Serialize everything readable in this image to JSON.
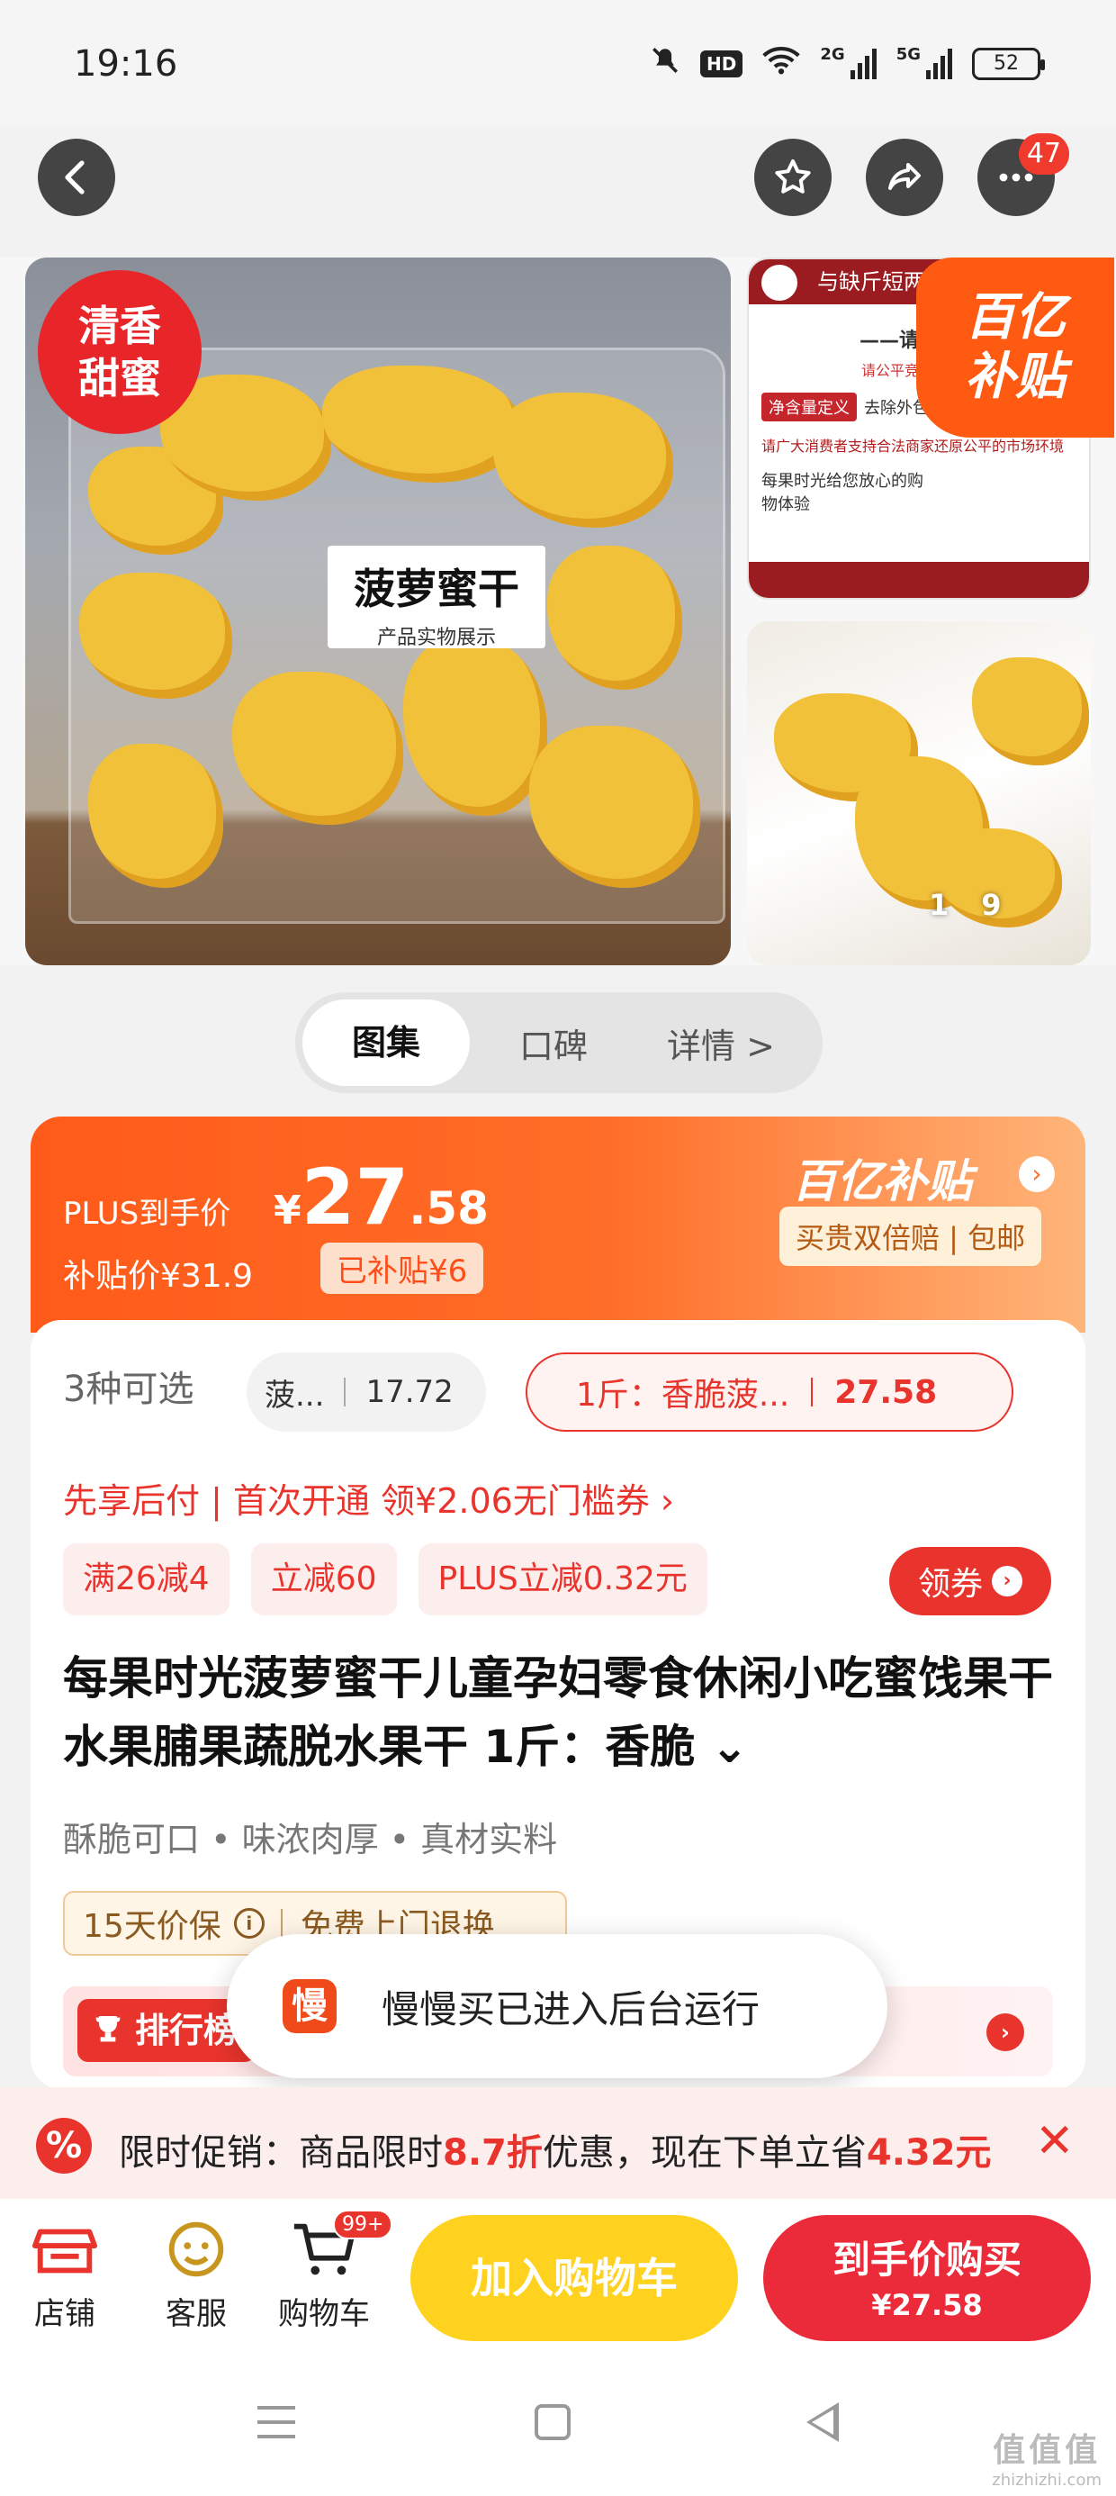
{
  "status_bar": {
    "time": "19:16",
    "hd": "HD",
    "net1": "2G",
    "net2": "5G",
    "battery": "52"
  },
  "top_nav": {
    "message_badge": "47"
  },
  "gallery": {
    "main_tag_line1": "清香",
    "main_tag_line2": "甜蜜",
    "product_label": "菠萝蜜干",
    "product_label_sub": "产品实物展示",
    "side1_header": "与缺斤短两",
    "side1_title": "——请认准购",
    "side1_sub": "请公平竞争，拒绝",
    "side1_pill": "净含量定义",
    "side1_pill_text": "去除外包装产品的净重",
    "side1_red": "请广大消费者支持合法商家还原公平的市场环境",
    "side1_small": "每果时光给您放心的购物体验",
    "subsidy_line1": "百亿",
    "subsidy_line2": "补贴",
    "page_current": "1",
    "page_total": "9"
  },
  "tabs": [
    {
      "label": "图集",
      "active": true
    },
    {
      "label": "口碑",
      "active": false
    },
    {
      "label": "详情 >",
      "active": false
    }
  ],
  "price": {
    "plus_label": "PLUS到手价",
    "yen": "¥",
    "int": "27",
    "dec": ".58",
    "subsidy_label": "补贴价¥31.9",
    "subsidized": "已补贴¥6",
    "brand": "百亿补贴",
    "guarantee": "买贵双倍赔 | 包邮"
  },
  "options": {
    "count_label": "3种可选",
    "opt1_name": "菠...",
    "opt1_price": "17.72",
    "opt2_name": "1斤：香脆菠...",
    "opt2_price": "27.58"
  },
  "promo_line": "先享后付 | 首次开通 领¥2.06无门槛券 ›",
  "chips": [
    "满26减4",
    "立减60",
    "PLUS立减0.32元"
  ],
  "coupon_button": "领券",
  "title": "每果时光菠萝蜜干儿童孕妇零食休闲小吃蜜饯果干水果脯果蔬脱水果干 1斤：香脆 ⌄",
  "features": "酥脆可口 • 味浓肉厚 • 真材实料",
  "guarantee": {
    "price_protect": "15天价保",
    "return": "免费上门退换"
  },
  "rank": {
    "label": "排行榜"
  },
  "toast": {
    "app_icon_char": "慢",
    "message": "慢慢买已进入后台运行"
  },
  "promo_strip": {
    "icon": "%",
    "prefix": "限时促销：商品限时",
    "discount": "8.7折",
    "middle": "优惠，现在下单立省",
    "save": "4.32元",
    "close": "✕"
  },
  "action_bar": {
    "shop": "店铺",
    "service": "客服",
    "cart": "购物车",
    "cart_badge": "99+",
    "add_to_cart": "加入购物车",
    "buy_line1": "到手价购买",
    "buy_line2": "¥27.58"
  },
  "watermark": {
    "line1": "值值值",
    "line2": "zhizhizhi.com"
  },
  "colors": {
    "accent_red": "#e8342c",
    "accent_orange": "#ff5a1a",
    "cart_yellow": "#ffd21f"
  }
}
